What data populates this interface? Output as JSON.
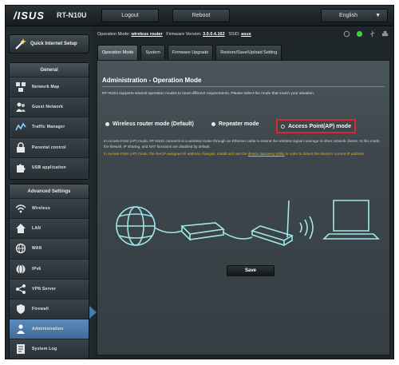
{
  "header": {
    "brand": "/ISUS",
    "model": "RT-N10U",
    "logout_label": "Logout",
    "reboot_label": "Reboot",
    "language": "English"
  },
  "status_bar": {
    "op_mode_label": "Operation Mode:",
    "op_mode_value": "wireless router",
    "firmware_label": "Firmware Version:",
    "firmware_value": "3.0.0.4.162",
    "ssid_label": "SSID:",
    "ssid_value": "asus"
  },
  "tabs": [
    {
      "label": "Operation Mode",
      "active": true
    },
    {
      "label": "System",
      "active": false
    },
    {
      "label": "Firmware Upgrade",
      "active": false
    },
    {
      "label": "Restore/Save/Upload Setting",
      "active": false
    }
  ],
  "sidebar": {
    "quick_setup": "Quick Internet Setup",
    "general_heading": "General",
    "general_items": [
      {
        "label": "Network Map",
        "icon": "network-map-icon"
      },
      {
        "label": "Guest Network",
        "icon": "guest-network-icon"
      },
      {
        "label": "Traffic Manager",
        "icon": "traffic-manager-icon"
      },
      {
        "label": "Parental control",
        "icon": "parental-control-icon"
      },
      {
        "label": "USB application",
        "icon": "usb-application-icon"
      }
    ],
    "advanced_heading": "Advanced Settings",
    "advanced_items": [
      {
        "label": "Wireless",
        "icon": "wireless-icon"
      },
      {
        "label": "LAN",
        "icon": "lan-icon"
      },
      {
        "label": "WAN",
        "icon": "wan-icon"
      },
      {
        "label": "IPv6",
        "icon": "ipv6-icon"
      },
      {
        "label": "VPN Server",
        "icon": "vpn-server-icon"
      },
      {
        "label": "Firewall",
        "icon": "firewall-icon"
      },
      {
        "label": "Administration",
        "icon": "administration-icon",
        "active": true
      },
      {
        "label": "System Log",
        "icon": "system-log-icon"
      }
    ]
  },
  "main": {
    "title": "Administration - Operation Mode",
    "description": "RT-N10U supports several operation modes to meet different requirements. Please select the mode that match your situation.",
    "modes": {
      "wireless_router": "Wireless router mode (Default)",
      "repeater": "Repeater mode",
      "access_point": "Access Point(AP) mode"
    },
    "selected_mode": "access_point",
    "info_line1": "In Access Point (AP) mode, RT-N10U connects to a wireless router through an Ethernet cable to extend the wireless signal coverage to other network clients. In this mode, the firewall, IP sharing, and NAT functions are disabled by default.",
    "info_line2_pre": "In Access Point (AP) mode, the DHCP-assigned IP address changes. Install and use the ",
    "info_line2_link": "device discovery utility",
    "info_line2_post": " in order to detect the device's current IP address.",
    "save_label": "Save"
  },
  "colors": {
    "accent_red": "#e0262a",
    "warning_text": "#f0b400",
    "diagram_cyan": "#9fe7ea",
    "active_nav": "#4a7aa6"
  }
}
